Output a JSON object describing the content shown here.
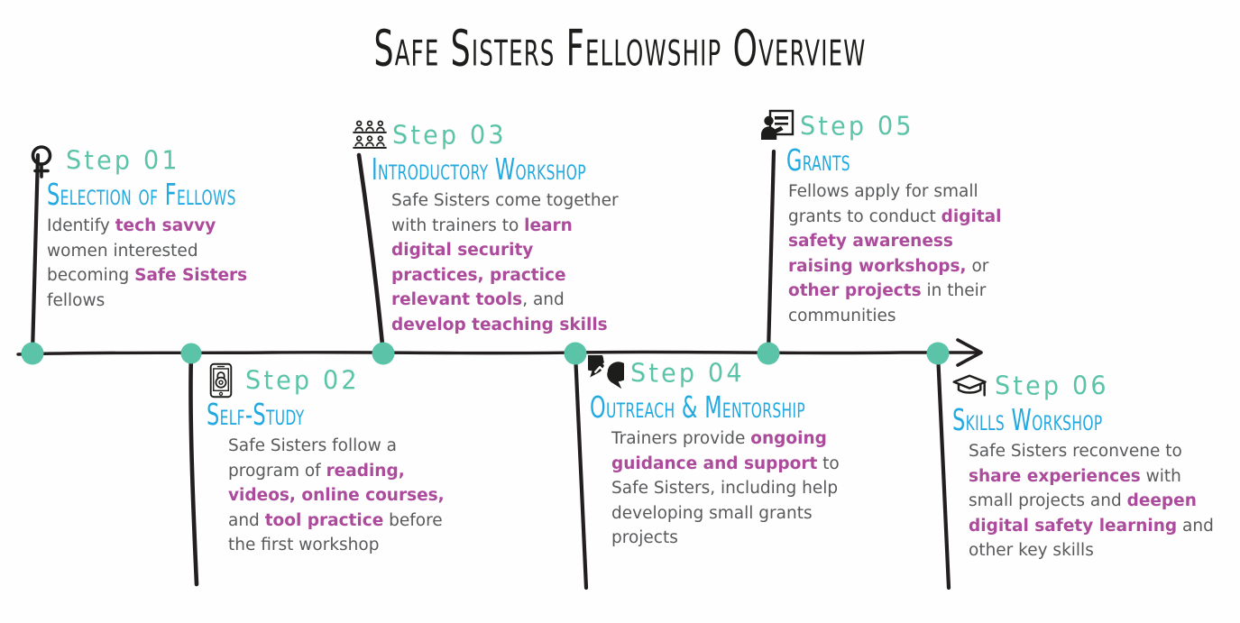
{
  "title": "Safe Sisters Fellowship Overview",
  "colors": {
    "teal": "#5bc4a8",
    "cyan": "#22a9e0",
    "purple": "#ac4a9b",
    "body_gray": "#58595b",
    "ink": "#1d1d1b"
  },
  "steps": [
    {
      "label": "Step 01",
      "title": "Selection of Fellows",
      "icon": "venus-symbol-icon",
      "body": [
        {
          "t": "Identify ",
          "b": false
        },
        {
          "t": "tech savvy",
          "b": true
        },
        {
          "t": " women interested becoming ",
          "b": false
        },
        {
          "t": "Safe Sisters",
          "b": true
        },
        {
          "t": " fellows",
          "b": false
        }
      ]
    },
    {
      "label": "Step 02",
      "title": "Self-Study",
      "icon": "phone-lock-icon",
      "body": [
        {
          "t": "Safe Sisters follow a program of ",
          "b": false
        },
        {
          "t": "reading, videos, online courses,",
          "b": true
        },
        {
          "t": " and ",
          "b": false
        },
        {
          "t": "tool practice",
          "b": true
        },
        {
          "t": " before the first workshop",
          "b": false
        }
      ]
    },
    {
      "label": "Step 03",
      "title": "Introductory Workshop",
      "icon": "audience-group-icon",
      "body": [
        {
          "t": "Safe Sisters come together with trainers to ",
          "b": false
        },
        {
          "t": "learn digital security practices, practice relevant tools",
          "b": true
        },
        {
          "t": ", and ",
          "b": false
        },
        {
          "t": "develop teaching skills",
          "b": true
        }
      ]
    },
    {
      "label": "Step 04",
      "title": "Outreach & Mentorship",
      "icon": "speech-bubbles-chart-icon",
      "body": [
        {
          "t": "Trainers provide ",
          "b": false
        },
        {
          "t": "ongoing guidance and support",
          "b": true
        },
        {
          "t": " to Safe Sisters, including help developing small grants projects",
          "b": false
        }
      ]
    },
    {
      "label": "Step 05",
      "title": "Grants",
      "icon": "presenter-board-icon",
      "body": [
        {
          "t": "Fellows apply for small grants to conduct ",
          "b": false
        },
        {
          "t": "digital safety awareness raising workshops,",
          "b": true
        },
        {
          "t": " or ",
          "b": false
        },
        {
          "t": "other projects",
          "b": true
        },
        {
          "t": " in their communities",
          "b": false
        }
      ]
    },
    {
      "label": "Step 06",
      "title": "Skills Workshop",
      "icon": "graduation-cap-icon",
      "body": [
        {
          "t": "Safe Sisters reconvene to ",
          "b": false
        },
        {
          "t": "share experiences",
          "b": true
        },
        {
          "t": " with small projects and ",
          "b": false
        },
        {
          "t": "deepen digital safety learning",
          "b": true
        },
        {
          "t": " and other key skills",
          "b": false
        }
      ]
    }
  ]
}
